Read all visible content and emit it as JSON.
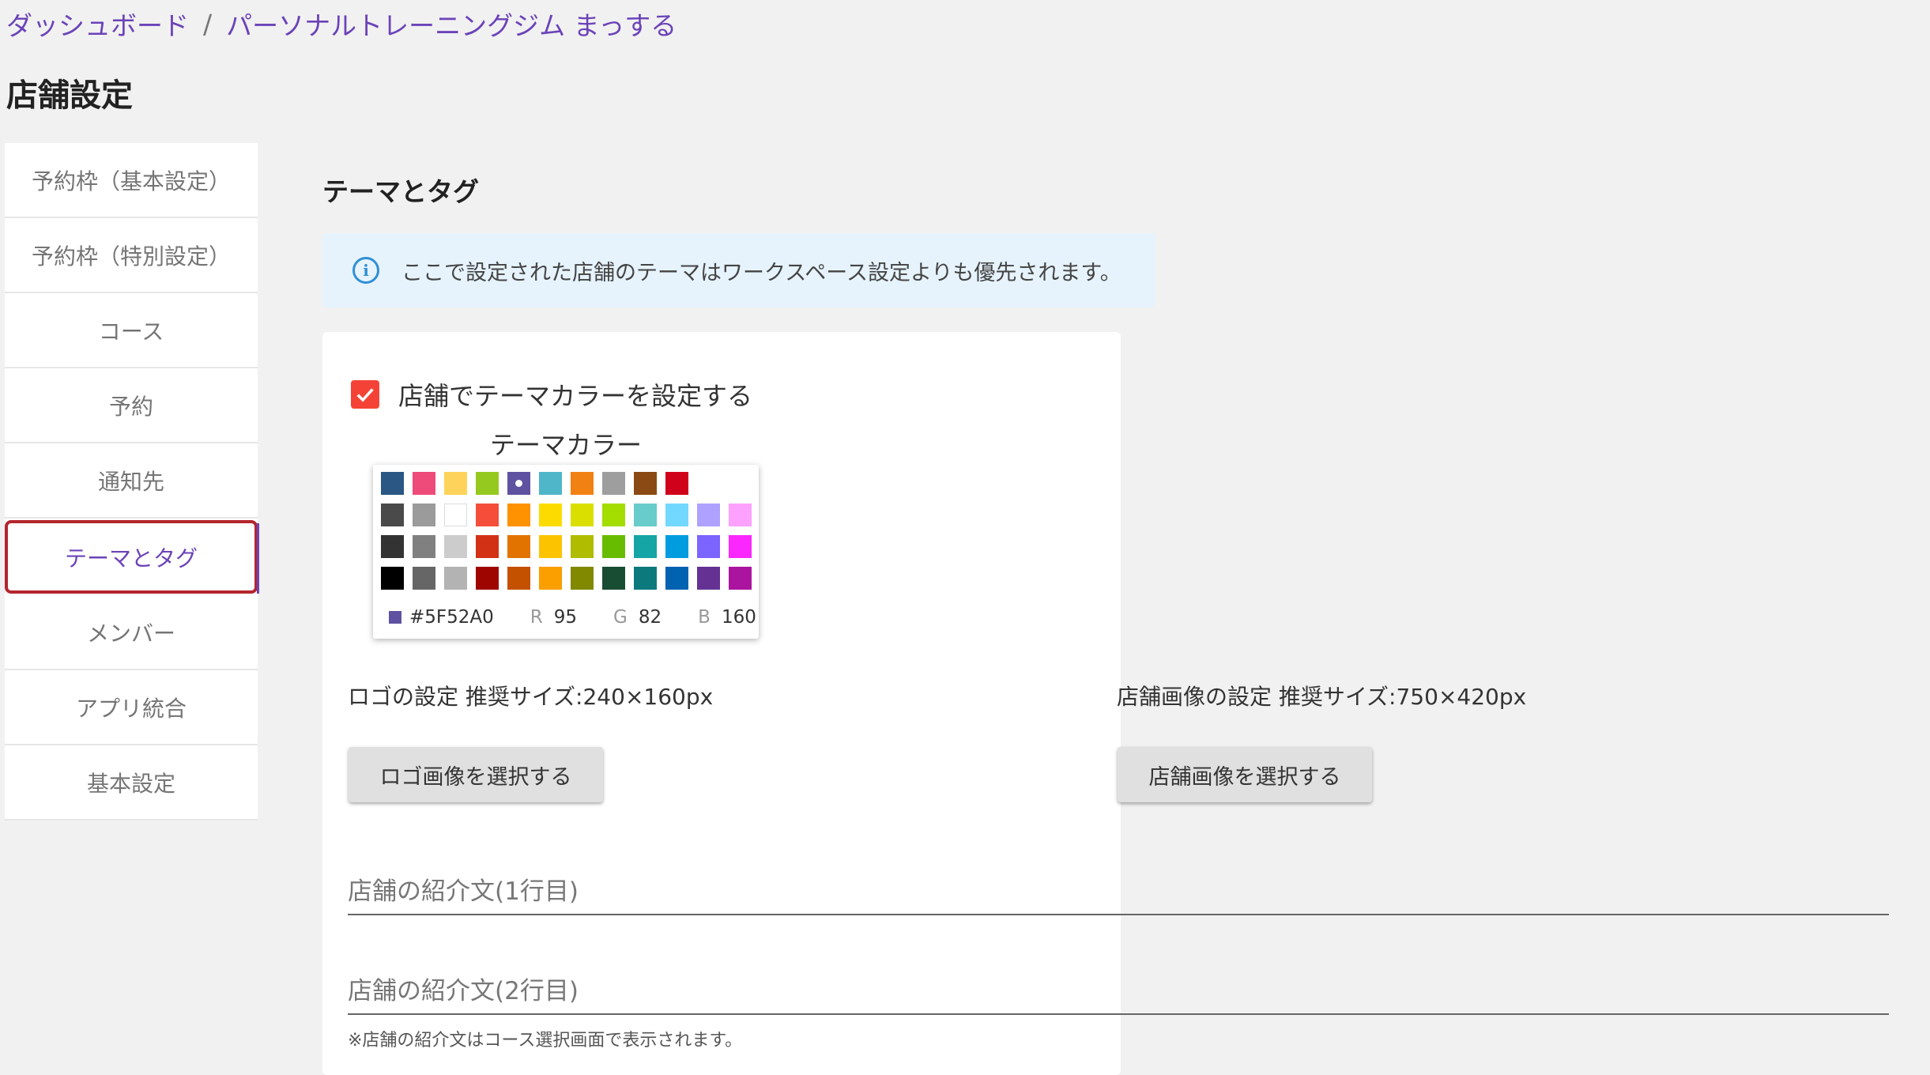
{
  "breadcrumb": {
    "items": [
      "ダッシュボード",
      "パーソナルトレーニングジム まっする"
    ],
    "separator": "/"
  },
  "page_title": "店舗設定",
  "sidebar": {
    "items": [
      {
        "label": "予約枠（基本設定）"
      },
      {
        "label": "予約枠（特別設定）"
      },
      {
        "label": "コース"
      },
      {
        "label": "予約"
      },
      {
        "label": "通知先"
      },
      {
        "label": "テーマとタグ",
        "active": true
      },
      {
        "label": "メンバー"
      },
      {
        "label": "アプリ統合"
      },
      {
        "label": "基本設定"
      }
    ]
  },
  "section_title": "テーマとタグ",
  "info_banner": {
    "icon": "info-icon",
    "text": "ここで設定された店舗のテーマはワークスペース設定よりも優先されます。"
  },
  "theme": {
    "checkbox_label": "店舗でテーマカラーを設定する",
    "checked": true,
    "color_label": "テーマカラー",
    "palette": [
      [
        "#2a5783",
        "#ee4b7a",
        "#fdd35b",
        "#96c91f",
        "#5f52a0",
        "#4fb6c9",
        "#f28114",
        "#9e9e9e",
        "#8b4a14",
        "#d0021b"
      ],
      [
        "#4a4a4a",
        "#9b9b9b",
        "#ffffff",
        "#f44e3b",
        "#fe9200",
        "#fcdc00",
        "#dbdf00",
        "#a4dd00",
        "#68ccca",
        "#73d8ff",
        "#aea1ff",
        "#fda1ff"
      ],
      [
        "#333333",
        "#808080",
        "#cccccc",
        "#d33115",
        "#e27300",
        "#fcc400",
        "#b0bc00",
        "#68bc00",
        "#16a5a5",
        "#009ce0",
        "#7b64ff",
        "#fa28ff"
      ],
      [
        "#000000",
        "#666666",
        "#b3b3b3",
        "#9f0500",
        "#c45100",
        "#fb9e00",
        "#808900",
        "#194d33",
        "#0c797d",
        "#0062b1",
        "#653294",
        "#ab149e"
      ]
    ],
    "selected_hex": "#5F52A0",
    "rgb": {
      "r_label": "R",
      "r": "95",
      "g_label": "G",
      "g": "82",
      "b_label": "B",
      "b": "160"
    }
  },
  "logo": {
    "label": "ロゴの設定 推奨サイズ:240×160px",
    "button": "ロゴ画像を選択する"
  },
  "store_image": {
    "label": "店舗画像の設定 推奨サイズ:750×420px",
    "button": "店舗画像を選択する"
  },
  "intro": {
    "line1_placeholder": "店舗の紹介文(1行目)",
    "line2_placeholder": "店舗の紹介文(2行目)",
    "help": "※店舗の紹介文はコース選択画面で表示されます。"
  }
}
